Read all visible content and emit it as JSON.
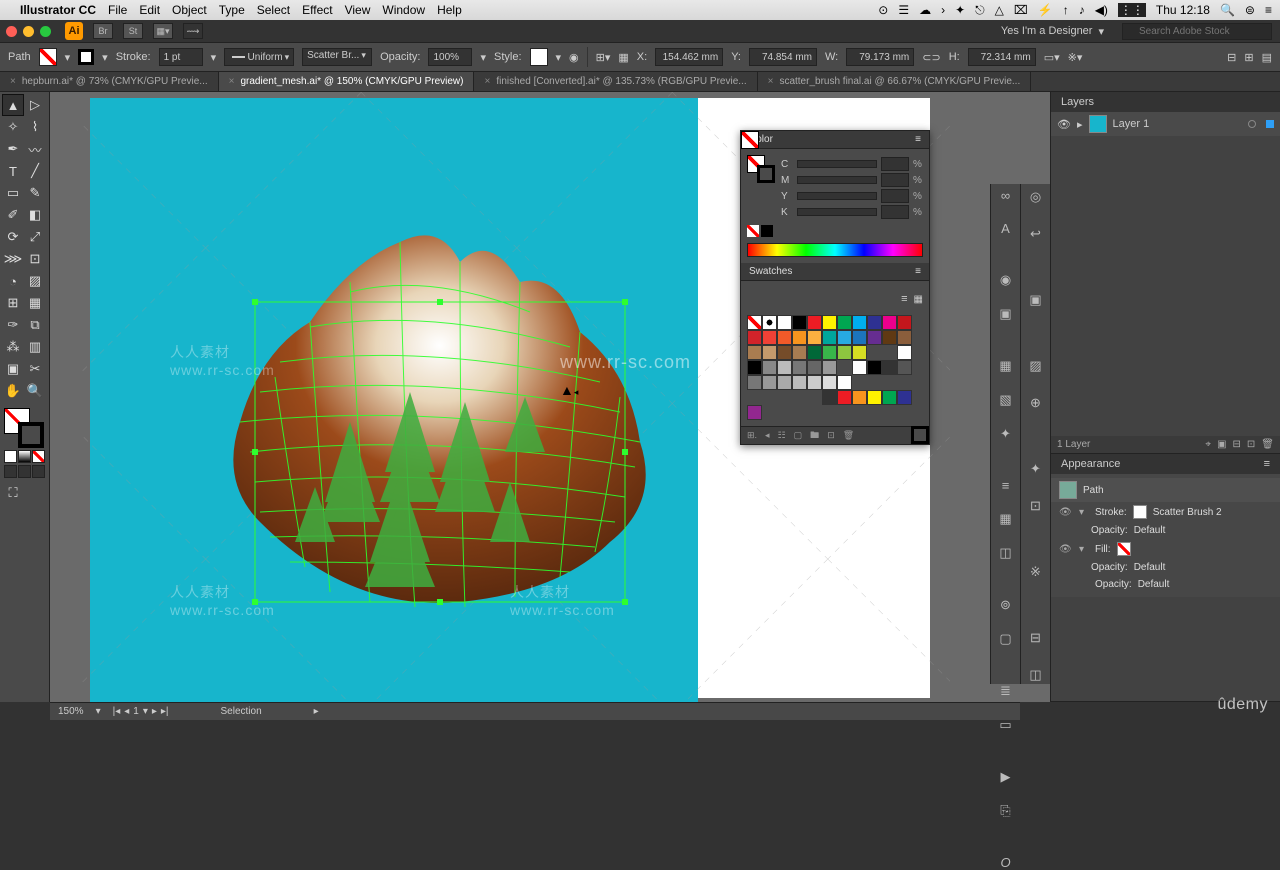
{
  "mac_menu": {
    "app": "Illustrator CC",
    "items": [
      "File",
      "Edit",
      "Object",
      "Type",
      "Select",
      "Effect",
      "View",
      "Window",
      "Help"
    ],
    "right_icons": [
      "⊙",
      "☰",
      "☁",
      "›",
      "✦",
      "⎋",
      "△",
      "✉",
      "⚡",
      "↑",
      "♪",
      "🔊"
    ],
    "flag": "⋮⋮",
    "day_time": "Thu 12:18",
    "extras": [
      "🔍",
      "⊜",
      "≡"
    ]
  },
  "window_bar": {
    "app_icon": "Ai",
    "user_label": "Yes I'm a Designer",
    "search_placeholder": "Search Adobe Stock"
  },
  "control_bar": {
    "path_label": "Path",
    "stroke_label": "Stroke:",
    "stroke_weight": "1 pt",
    "stroke_profile": "Uniform",
    "brush_label": "Scatter Br...",
    "opacity_label": "Opacity:",
    "opacity_value": "100%",
    "style_label": "Style:",
    "x_label": "X:",
    "x_val": "154.462 mm",
    "y_label": "Y:",
    "y_val": "74.854 mm",
    "w_label": "W:",
    "w_val": "79.173 mm",
    "h_label": "H:",
    "h_val": "72.314 mm"
  },
  "doc_tabs": [
    {
      "name": "hepburn.ai* @ 73% (CMYK/GPU Previe...",
      "active": false
    },
    {
      "name": "gradient_mesh.ai* @ 150% (CMYK/GPU Preview)",
      "active": true
    },
    {
      "name": "finished [Converted].ai* @ 135.73% (RGB/GPU Previe...",
      "active": false
    },
    {
      "name": "scatter_brush final.ai @ 66.67% (CMYK/GPU Previe...",
      "active": false
    }
  ],
  "color_panel": {
    "title": "Color",
    "channels": [
      "C",
      "M",
      "Y",
      "K"
    ]
  },
  "swatches_panel": {
    "title": "Swatches",
    "rows": [
      [
        "none",
        "reg",
        "#ffffff",
        "#000000",
        "#ed1c24",
        "#fff200",
        "#00a651",
        "#00aeef",
        "#2e3192",
        "#ec008c"
      ],
      [
        "#c4161c",
        "#d2232a",
        "#ef4136",
        "#f15a29",
        "#f7941e",
        "#fbb040",
        "#00a79d",
        "#27aae1",
        "#1c75bc",
        "#662d91"
      ],
      [
        "#603913",
        "#8b5e3c",
        "#a97c50",
        "#c49a6c",
        "#754c29",
        "#a67c52",
        "#006838",
        "#39b54a",
        "#8dc63f",
        "#d7df23"
      ],
      [
        "",
        "",
        "#ffffff",
        "#000000",
        "#888888",
        "#bbbbbb",
        "#777777",
        "#666666",
        "#999999",
        ""
      ],
      [
        "#ffffff",
        "#000000",
        "#333333",
        "#555555",
        "#777777",
        "#999999",
        "#aaaaaa",
        "#bbbbbb",
        "#cccccc",
        "#dddddd"
      ],
      [
        "#ffffff",
        "",
        "",
        "",
        "",
        "",
        "",
        "",
        "",
        ""
      ],
      [
        "#333333",
        "#ed1c24",
        "#f7941e",
        "#fff200",
        "#00a651",
        "#2e3192",
        "#92278f",
        "",
        "",
        ""
      ]
    ]
  },
  "layers": {
    "title": "Layers",
    "items": [
      {
        "name": "Layer 1"
      }
    ],
    "footer_label": "1 Layer"
  },
  "appearance": {
    "title": "Appearance",
    "path_label": "Path",
    "rows": [
      {
        "kind": "stroke",
        "label": "Stroke:",
        "value": "Scatter Brush 2"
      },
      {
        "kind": "opacity",
        "label": "Opacity:",
        "value": "Default"
      },
      {
        "kind": "fill",
        "label": "Fill:",
        "value": ""
      },
      {
        "kind": "opacity",
        "label": "Opacity:",
        "value": "Default"
      },
      {
        "kind": "opacity-main",
        "label": "Opacity:",
        "value": "Default"
      }
    ]
  },
  "status": {
    "zoom": "150%",
    "page": "1",
    "label": "Selection"
  },
  "watermarks": {
    "chinese": "人人素材",
    "url": "www.rr-sc.com"
  },
  "udemy": "ûdemy"
}
